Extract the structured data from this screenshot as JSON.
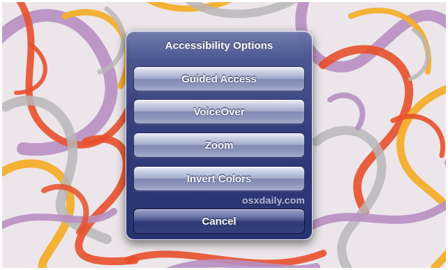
{
  "dialog": {
    "title": "Accessibility Options",
    "options": [
      {
        "label": "Guided Access"
      },
      {
        "label": "VoiceOver"
      },
      {
        "label": "Zoom"
      },
      {
        "label": "Invert Colors"
      }
    ],
    "cancel_label": "Cancel"
  },
  "watermark": "osxdaily.com",
  "colors": {
    "dialog_background": "#2c3a78",
    "button_light": "#c7cde2",
    "button_dark": "#7f89b2",
    "wallpaper_base": "#ece6ea",
    "stroke_orange": "#e8502c",
    "stroke_yellow": "#f3ae2c",
    "stroke_lavender": "#b88fc2",
    "stroke_gray": "#b9b6b9"
  }
}
